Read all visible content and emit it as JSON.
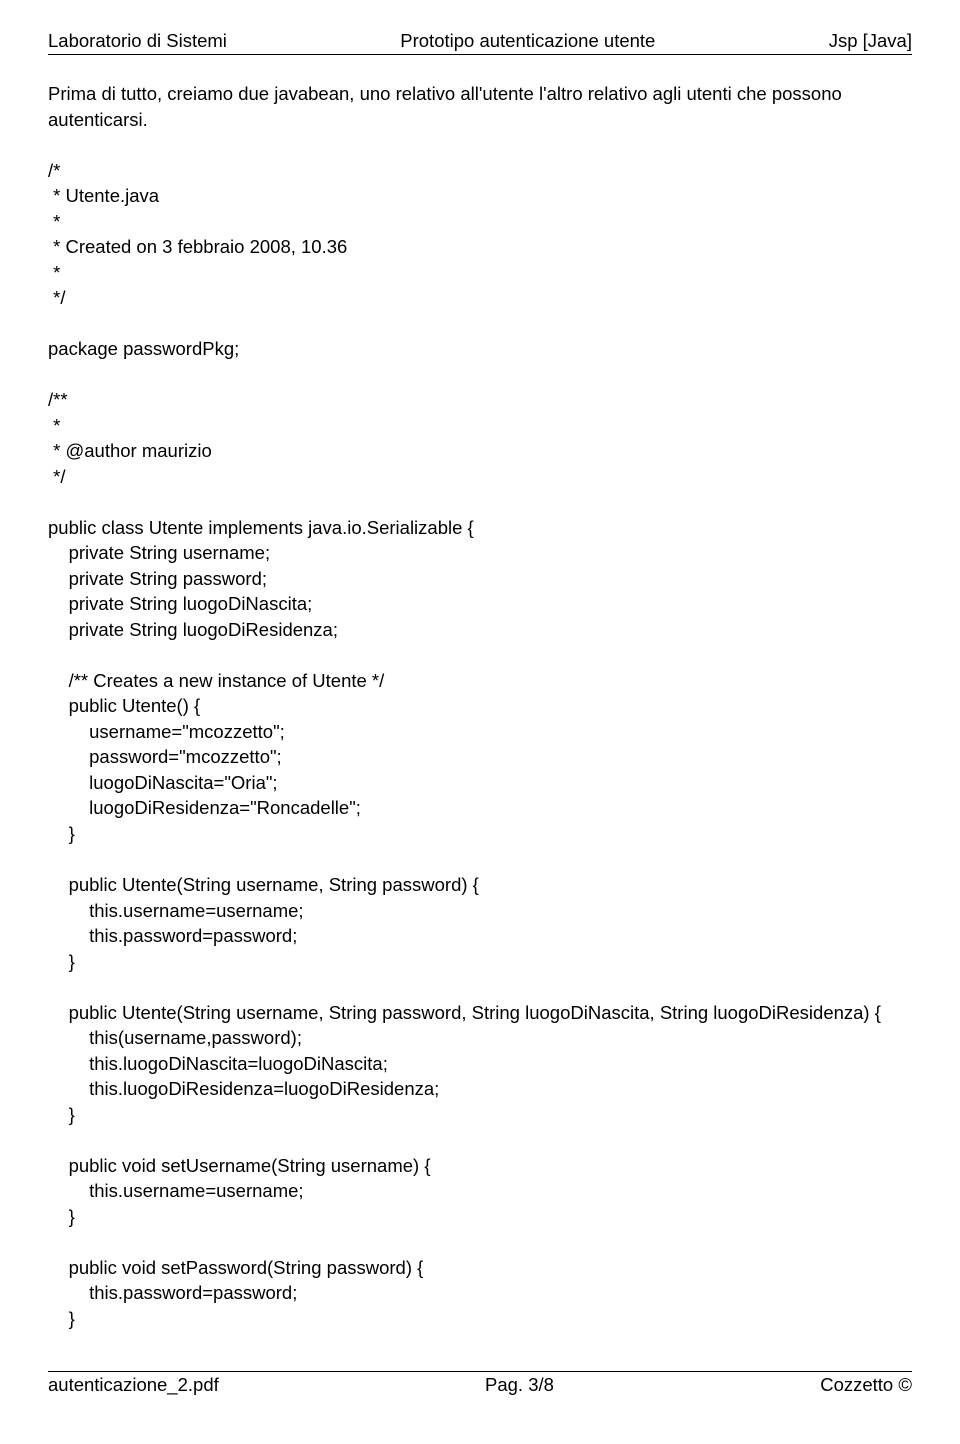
{
  "header": {
    "left": "Laboratorio di Sistemi",
    "center": "Prototipo autenticazione utente",
    "right": "Jsp [Java]"
  },
  "body": "Prima di tutto, creiamo due javabean, uno relativo all'utente l'altro relativo agli utenti che possono autenticarsi.\n\n/*\n * Utente.java\n *\n * Created on 3 febbraio 2008, 10.36\n *\n */\n\npackage passwordPkg;\n\n/**\n *\n * @author maurizio\n */\n\npublic class Utente implements java.io.Serializable {\n    private String username;\n    private String password;\n    private String luogoDiNascita;\n    private String luogoDiResidenza;\n\n    /** Creates a new instance of Utente */\n    public Utente() {\n        username=\"mcozzetto\";\n        password=\"mcozzetto\";\n        luogoDiNascita=\"Oria\";\n        luogoDiResidenza=\"Roncadelle\";\n    }\n\n    public Utente(String username, String password) {\n        this.username=username;\n        this.password=password;\n    }\n\n    public Utente(String username, String password, String luogoDiNascita, String luogoDiResidenza) {\n        this(username,password);\n        this.luogoDiNascita=luogoDiNascita;\n        this.luogoDiResidenza=luogoDiResidenza;\n    }\n\n    public void setUsername(String username) {\n        this.username=username;\n    }\n\n    public void setPassword(String password) {\n        this.password=password;\n    }",
  "footer": {
    "left": "autenticazione_2.pdf",
    "center": "Pag. 3/8",
    "right": "Cozzetto ©"
  }
}
